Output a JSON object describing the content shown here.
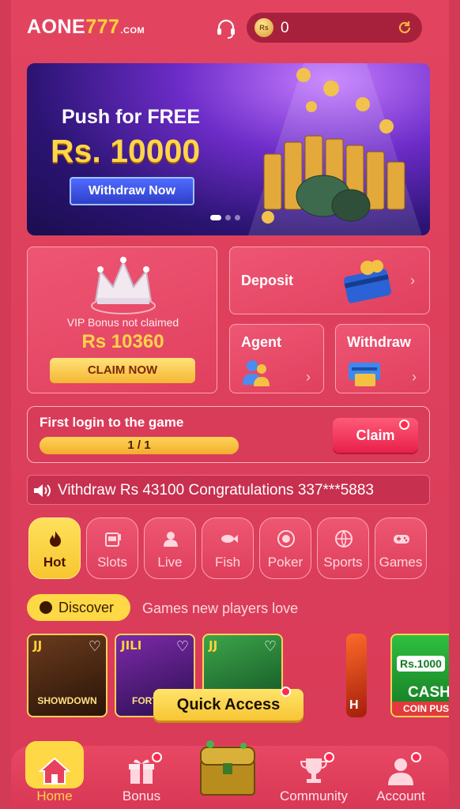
{
  "header": {
    "logo_main": "AONE",
    "logo_num": "777",
    "logo_suffix": ".COM",
    "balance": "0",
    "coin_symbol": "Rs"
  },
  "banner": {
    "line1": "Push for FREE",
    "line2": "Rs. 10000",
    "button": "Withdraw Now"
  },
  "vip": {
    "label": "VIP Bonus not claimed",
    "amount": "Rs 10360",
    "button": "CLAIM NOW"
  },
  "actions": {
    "deposit": "Deposit",
    "agent": "Agent",
    "withdraw": "Withdraw"
  },
  "task": {
    "title": "First login to the game",
    "progress_text": "1 / 1",
    "progress_fraction": 1.0,
    "button": "Claim"
  },
  "marquee": {
    "text": "Vithdraw   Rs 43100    Congratulations 337***5883"
  },
  "categories": [
    {
      "label": "Hot",
      "icon": "flame-icon"
    },
    {
      "label": "Slots",
      "icon": "slot-machine-icon"
    },
    {
      "label": "Live",
      "icon": "dealer-icon"
    },
    {
      "label": "Fish",
      "icon": "fish-icon"
    },
    {
      "label": "Poker",
      "icon": "poker-chip-icon"
    },
    {
      "label": "Sports",
      "icon": "ball-icon"
    },
    {
      "label": "Games",
      "icon": "gamepad-icon"
    }
  ],
  "discover": {
    "label": "Discover",
    "subtitle": "Games new players love"
  },
  "games": {
    "tile1_badge": "JJ",
    "tile1_title": "SHOWDOWN",
    "tile2_badge": "JILI",
    "tile2_title": "FORTUNE",
    "tile3_badge": "JJ",
    "tile4_text": "H",
    "tile5_price": "Rs.1000",
    "tile5_title": "CASH",
    "tile5_footer": "COIN PUS"
  },
  "quick_access": "Quick Access",
  "nav": {
    "home": "Home",
    "bonus": "Bonus",
    "community": "Community",
    "account": "Account"
  },
  "colors": {
    "background": "#dc3f5b",
    "accent_yellow": "#ffd846",
    "claim_red": "#e8204a"
  }
}
